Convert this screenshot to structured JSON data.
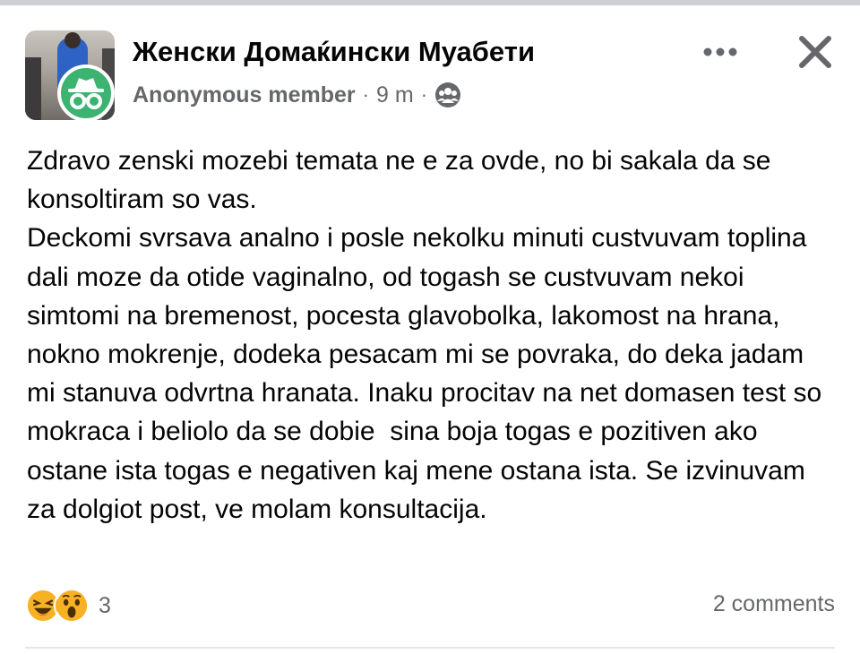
{
  "post": {
    "group_name": "Женски Домаќински Муабети",
    "author": "Anonymous member",
    "separator": "·",
    "time": "9 m",
    "audience_icon": "group-audience-icon",
    "more_icon": "more-options-icon",
    "close_icon": "close-icon",
    "body": [
      "Zdravo zenski mozebi temata ne e za ovde, no bi sakala da se konsoltiram so vas.",
      "Deckomi svrsava analno i posle nekolku minuti custvuvam toplina dali moze da otide vaginalno, od togash se custvuvam nekoi simtomi na bremenost, pocesta glavobolka, lakomost na hrana, nokno mokrenje, dodeka pesacam mi se povraka, do deka jadam mi stanuva odvrtna hranata. Inaku procitav na net domasen test so mokraca i beliolo da se dobie  sina boja togas e pozitiven ako ostane ista togas e negativen kaj mene ostana ista. Se izvinuvam za dolgiot post, ve molam konsultacija."
    ],
    "reactions": [
      "haha-icon",
      "wow-icon"
    ],
    "reaction_count": "3",
    "comments": "2 comments"
  },
  "colors": {
    "text_primary": "#050505",
    "text_secondary": "#65676b",
    "anonymous_badge": "#3cb371",
    "reaction_yellow": "#f7b125",
    "divider": "#e4e6eb"
  }
}
